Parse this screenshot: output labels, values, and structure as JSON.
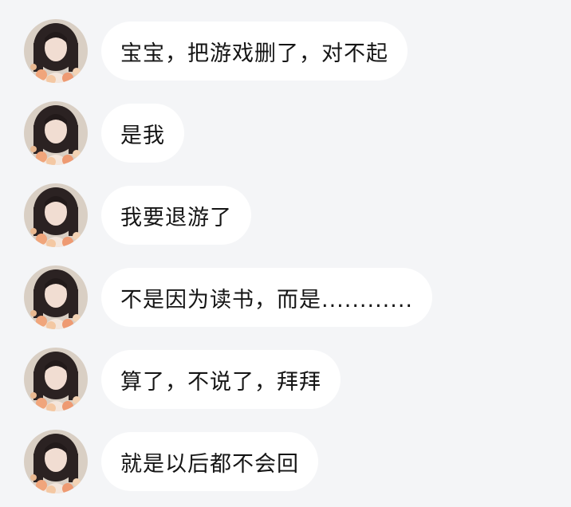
{
  "contact": {
    "avatar_icon": "girl-portrait-avatar"
  },
  "messages": [
    {
      "text": "宝宝，把游戏删了，对不起"
    },
    {
      "text": "是我"
    },
    {
      "text": "我要退游了"
    },
    {
      "text": "不是因为读书，而是............"
    },
    {
      "text": "算了，不说了，拜拜"
    },
    {
      "text": "就是以后都不会回"
    }
  ]
}
